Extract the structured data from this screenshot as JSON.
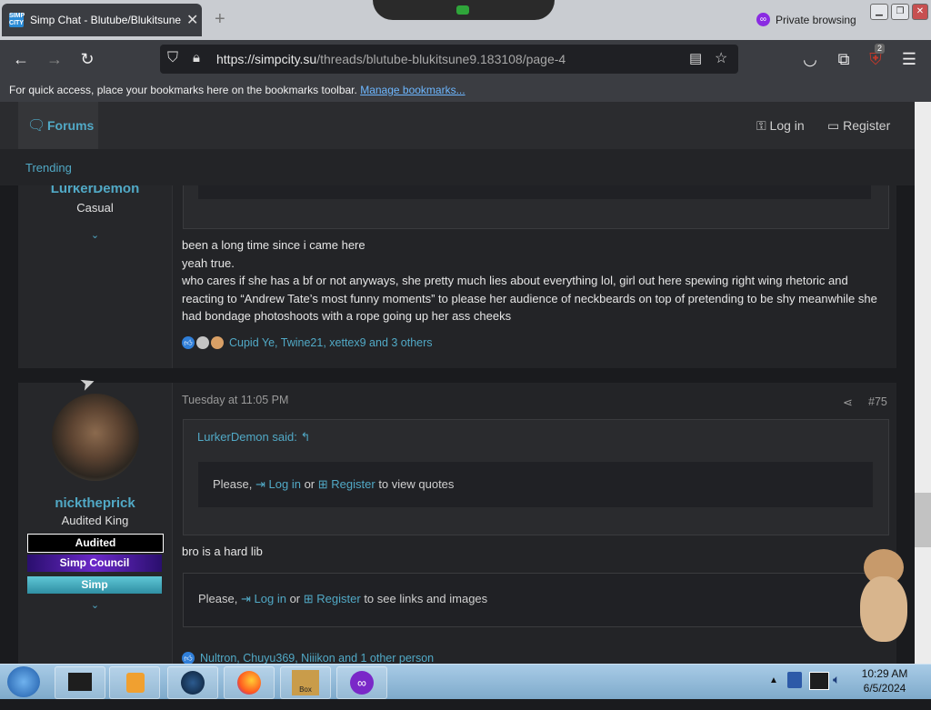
{
  "browser": {
    "tab_title": "Simp Chat - Blutube/Blukitsune",
    "tab_favicon_text": "SIMP CITY",
    "private_label": "Private browsing",
    "url_host": "https://simpcity.su",
    "url_path": "/threads/blutube-blukitsune9.183108/page-4",
    "extension_badge": "2",
    "bookmarks_text": "For quick access, place your bookmarks here on the bookmarks toolbar.",
    "bookmarks_link": "Manage bookmarks..."
  },
  "site": {
    "nav_forums": "Forums",
    "nav_trending": "Trending",
    "login": "Log in",
    "register": "Register"
  },
  "post1": {
    "username": "LurkerDemon",
    "user_title": "Casual",
    "lines": [
      "been a long time since i came here",
      "yeah true.",
      "who cares if she has a bf or not anyways, she pretty much lies about everything lol, girl out here spewing right wing rhetoric and reacting to “Andrew Tate’s most funny moments” to please her audience of neckbeards on top of pretending to be shy meanwhile she had bondage photoshoots with a rope going up her ass cheeks"
    ],
    "reactions": "Cupid Ye, Twine21, xettex9 and 3 others"
  },
  "post2": {
    "username": "nicktheprick",
    "user_title": "Audited King",
    "badges": [
      "Audited",
      "Simp Council",
      "Simp"
    ],
    "timestamp": "Tuesday at 11:05 PM",
    "post_number": "#75",
    "quote_author": "LurkerDemon said:",
    "quote_prefix": "Please,",
    "quote_login": "Log in",
    "quote_or": "or",
    "quote_register": "Register",
    "quote_suffix": "to view quotes",
    "body": "bro is a hard lib",
    "links_prefix": "Please,",
    "links_login": "Log in",
    "links_or": "or",
    "links_register": "Register",
    "links_suffix": "to see links and images",
    "reactions": "Nultron, Chuyu369, Niiikon and 1 other person"
  },
  "taskbar": {
    "time": "10:29 AM",
    "date": "6/5/2024",
    "box_label": "Box"
  },
  "colors": {
    "accent": "#51a9c6",
    "bg": "#1a1b1e",
    "panel": "#232427"
  }
}
